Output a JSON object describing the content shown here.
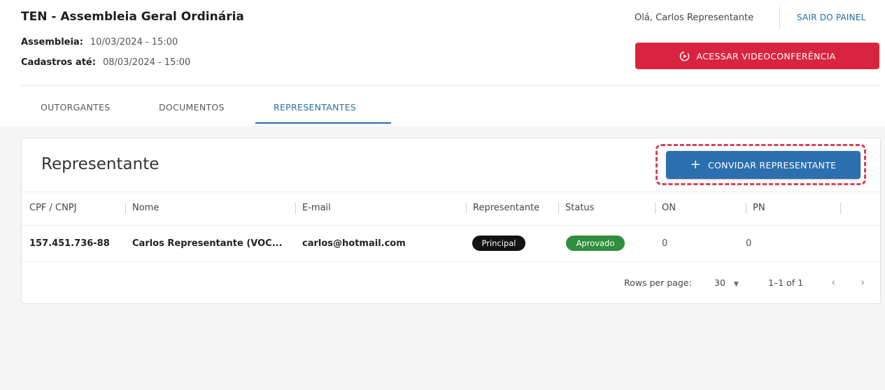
{
  "header": {
    "title": "TEN - Assembleia Geral Ordinária",
    "assembleia_label": "Assembleia:",
    "assembleia_value": "10/03/2024 - 15:00",
    "cadastros_label": "Cadastros até:",
    "cadastros_value": "08/03/2024 - 15:00",
    "greeting": "Olá, Carlos Representante",
    "logout": "SAIR DO PAINEL",
    "video_button": "ACESSAR VIDEOCONFERÊNCIA"
  },
  "tabs": [
    {
      "label": "OUTORGANTES",
      "active": false
    },
    {
      "label": "DOCUMENTOS",
      "active": false
    },
    {
      "label": "REPRESENTANTES",
      "active": true
    }
  ],
  "card": {
    "title": "Representante",
    "invite_button": "CONVIDAR REPRESENTANTE",
    "columns": [
      "CPF / CNPJ",
      "Nome",
      "E-mail",
      "Representante",
      "Status",
      "ON",
      "PN"
    ],
    "rows": [
      {
        "cpf": "157.451.736-88",
        "nome": "Carlos Representante (VOC...",
        "email": "carlos@hotmail.com",
        "representante": "Principal",
        "status": "Aprovado",
        "on": "0",
        "pn": "0"
      }
    ],
    "footer": {
      "rows_per_page_label": "Rows per page:",
      "rows_per_page_value": "30",
      "range": "1–1 of 1"
    }
  },
  "colors": {
    "accent_blue": "#2c6fae",
    "video_red": "#d9243f",
    "highlight_dashed": "#d6405e",
    "status_green": "#2f8f3d"
  }
}
